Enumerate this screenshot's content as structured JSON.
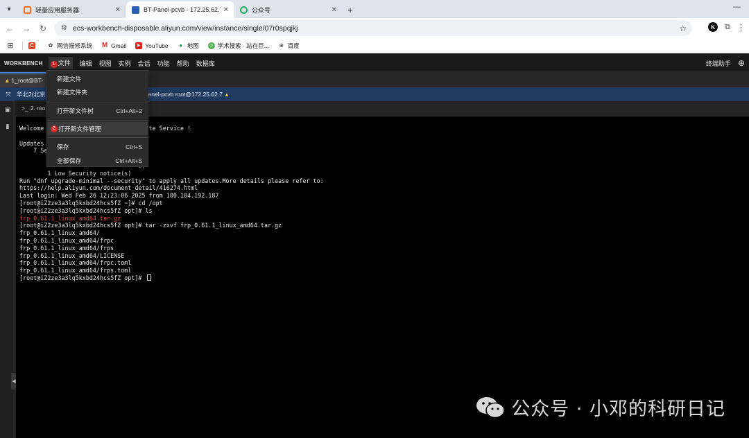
{
  "browser": {
    "tabs": [
      {
        "title": "轻量应用服务器",
        "color": "#f0702a"
      },
      {
        "title": "BT-Panel-pcvb - 172.25.62.7",
        "color": "#2b5fb4"
      },
      {
        "title": "公众号",
        "color": "#1ab35c"
      }
    ],
    "url": "ecs-workbench-disposable.aliyun.com/view/instance/single/07r0spqjkj",
    "avatar_letter": "K",
    "bookmarks": [
      {
        "label": "网信报修系统",
        "icon": "paw-icon"
      },
      {
        "label": "Gmail",
        "icon": "gmail-icon"
      },
      {
        "label": "YouTube",
        "icon": "youtube-icon"
      },
      {
        "label": "地图",
        "icon": "maps-icon"
      },
      {
        "label": "学术搜索 · 站在巨...",
        "icon": "scholar-icon"
      },
      {
        "label": "百度",
        "icon": "globe-icon"
      }
    ]
  },
  "workbench": {
    "logo": "WORKBENCH",
    "menus": [
      "文件",
      "编辑",
      "视图",
      "实例",
      "会话",
      "功能",
      "帮助",
      "数据库"
    ],
    "file_badge": "1",
    "right_label": "终端助手",
    "session_tab": "1_root@BT-",
    "info_region": "华北2(北京",
    "info_rest": "8  BT-Panel-pcvb   root@172.25.62.7",
    "terminal_tab": "2. roo"
  },
  "file_menu": {
    "items": [
      {
        "label": "新建文件",
        "shortcut": ""
      },
      {
        "label": "新建文件夹",
        "shortcut": ""
      },
      {
        "label": "打开新文件树",
        "shortcut": "Ctrl+Alt+2"
      },
      {
        "label": "打开新文件管理",
        "shortcut": "",
        "badge": "2"
      },
      {
        "label": "保存",
        "shortcut": "Ctrl+S"
      },
      {
        "label": "全部保存",
        "shortcut": "Ctrl+Alt+S"
      }
    ]
  },
  "terminal": {
    "lines": [
      {
        "text": "Welcome                           mpute Service !",
        "color": ""
      },
      {
        "text": "",
        "color": ""
      },
      {
        "text": "Updates                           ble",
        "color": ""
      },
      {
        "text": "    7 Se",
        "color": ""
      },
      {
        "text": "                                  (s)",
        "color": ""
      },
      {
        "text": "                                  s)",
        "color": ""
      },
      {
        "text": "        1 Low Security notice(s)",
        "color": ""
      },
      {
        "text": "Run \"dnf upgrade-minimal --security\" to apply all updates.More details please refer to:",
        "color": ""
      },
      {
        "text": "https://help.aliyun.com/document_detail/416274.html",
        "color": ""
      },
      {
        "text": "Last login: Wed Feb 26 12:23:06 2025 from 100.104.192.187",
        "color": ""
      },
      {
        "text": "[root@iZ2ze3a3lq5kxbd24hcs5fZ ~]# cd /opt",
        "color": ""
      },
      {
        "text": "[root@iZ2ze3a3lq5kxbd24hcs5fZ opt]# ls",
        "color": ""
      },
      {
        "text": "frp_0.61.1_linux_amd64.tar.gz",
        "color": "red"
      },
      {
        "text": "[root@iZ2ze3a3lq5kxbd24hcs5fZ opt]# tar -zxvf frp_0.61.1_linux_amd64.tar.gz",
        "color": ""
      },
      {
        "text": "frp_0.61.1_linux_amd64/",
        "color": ""
      },
      {
        "text": "frp_0.61.1_linux_amd64/frpc",
        "color": ""
      },
      {
        "text": "frp_0.61.1_linux_amd64/frps",
        "color": ""
      },
      {
        "text": "frp_0.61.1_linux_amd64/LICENSE",
        "color": ""
      },
      {
        "text": "frp_0.61.1_linux_amd64/frpc.toml",
        "color": ""
      },
      {
        "text": "frp_0.61.1_linux_amd64/frps.toml",
        "color": ""
      },
      {
        "text": "[root@iZ2ze3a3lq5kxbd24hcs5fZ opt]# ",
        "color": "",
        "cursor": true
      }
    ]
  },
  "watermark": {
    "text": "公众号 · 小邓的科研日记"
  }
}
